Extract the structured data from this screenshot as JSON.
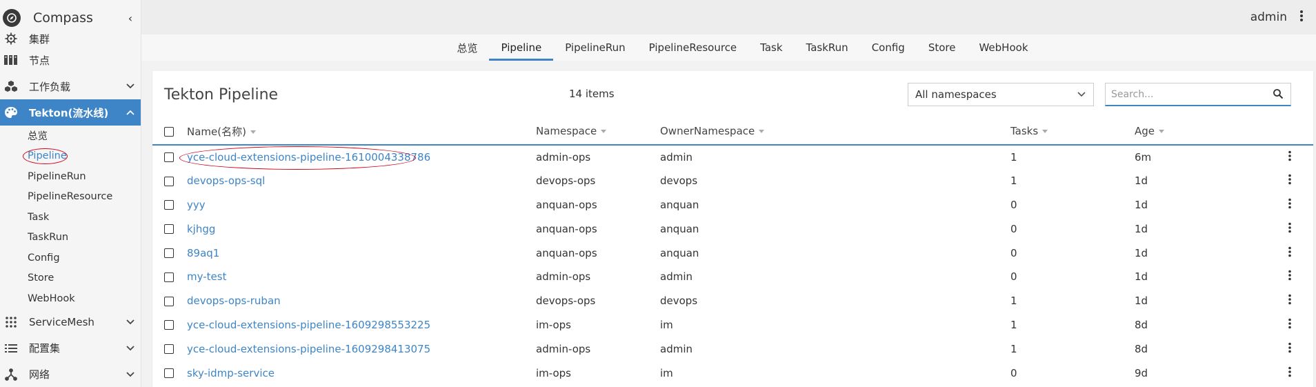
{
  "app": {
    "title": "Compass",
    "collapse_glyph": "‹",
    "user": "admin"
  },
  "sidebar": {
    "items": [
      {
        "label": "集群",
        "icon": "helm-icon",
        "has_chevron": false
      },
      {
        "label": "节点",
        "icon": "server-rack-icon",
        "has_chevron": false
      },
      {
        "label": "工作负载",
        "icon": "cubes-icon",
        "has_chevron": true
      },
      {
        "label": "Tekton(流水线)",
        "icon": "palette-icon",
        "has_chevron": true,
        "active": true
      },
      {
        "label": "ServiceMesh",
        "icon": "grid-dots-icon",
        "has_chevron": true
      },
      {
        "label": "配置集",
        "icon": "list-icon",
        "has_chevron": true
      },
      {
        "label": "网络",
        "icon": "network-icon",
        "has_chevron": true
      }
    ],
    "subitems": [
      "总览",
      "Pipeline",
      "PipelineRun",
      "PipelineResource",
      "Task",
      "TaskRun",
      "Config",
      "Store",
      "WebHook"
    ]
  },
  "tabs": [
    "总览",
    "Pipeline",
    "PipelineRun",
    "PipelineResource",
    "Task",
    "TaskRun",
    "Config",
    "Store",
    "WebHook"
  ],
  "active_tab": "Pipeline",
  "panel": {
    "title": "Tekton Pipeline",
    "item_count": "14 items",
    "namespace_select": "All namespaces",
    "search_placeholder": "Search..."
  },
  "table": {
    "columns": [
      "Name(名称)",
      "Namespace",
      "OwnerNamespace",
      "Tasks",
      "Age"
    ],
    "rows": [
      {
        "name": "yce-cloud-extensions-pipeline-1610004338786",
        "namespace": "admin-ops",
        "owner": "admin",
        "tasks": "1",
        "age": "6m"
      },
      {
        "name": "devops-ops-sql",
        "namespace": "devops-ops",
        "owner": "devops",
        "tasks": "1",
        "age": "1d"
      },
      {
        "name": "yyy",
        "namespace": "anquan-ops",
        "owner": "anquan",
        "tasks": "0",
        "age": "1d"
      },
      {
        "name": "kjhgg",
        "namespace": "anquan-ops",
        "owner": "anquan",
        "tasks": "0",
        "age": "1d"
      },
      {
        "name": "89aq1",
        "namespace": "anquan-ops",
        "owner": "anquan",
        "tasks": "0",
        "age": "1d"
      },
      {
        "name": "my-test",
        "namespace": "admin-ops",
        "owner": "admin",
        "tasks": "0",
        "age": "1d"
      },
      {
        "name": "devops-ops-ruban",
        "namespace": "devops-ops",
        "owner": "devops",
        "tasks": "1",
        "age": "1d"
      },
      {
        "name": "yce-cloud-extensions-pipeline-1609298553225",
        "namespace": "im-ops",
        "owner": "im",
        "tasks": "1",
        "age": "8d"
      },
      {
        "name": "yce-cloud-extensions-pipeline-1609298413075",
        "namespace": "admin-ops",
        "owner": "admin",
        "tasks": "1",
        "age": "8d"
      },
      {
        "name": "sky-idmp-service",
        "namespace": "im-ops",
        "owner": "im",
        "tasks": "0",
        "age": "9d"
      }
    ]
  },
  "colors": {
    "accent": "#3d85c6",
    "annotation_red": "#d0021b"
  }
}
